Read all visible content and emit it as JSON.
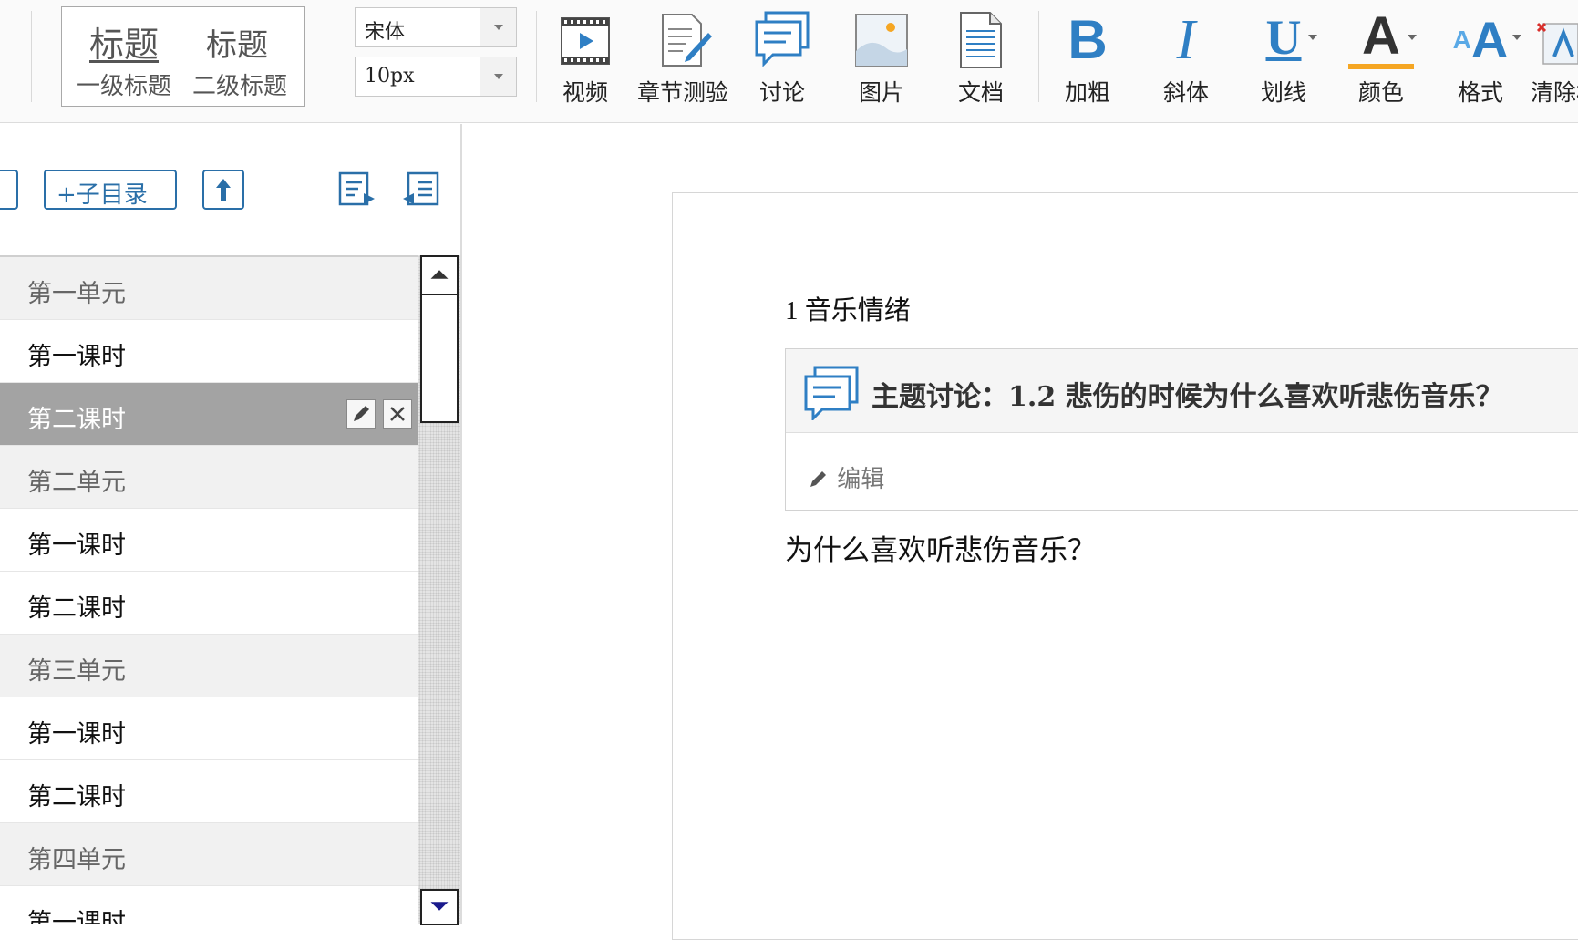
{
  "toolbar": {
    "heading": {
      "h1": "标题",
      "h2": "标题",
      "h1_sub": "一级标题",
      "h2_sub": "二级标题"
    },
    "font_family": "宋体",
    "font_size": "10px",
    "tools": {
      "video": "视频",
      "quiz": "章节测验",
      "discussion": "讨论",
      "image": "图片",
      "document": "文档",
      "bold": "加粗",
      "italic": "斜体",
      "underline": "划线",
      "color": "颜色",
      "format": "格式",
      "clear": "清除格"
    },
    "glyphs": {
      "bold": "B",
      "italic": "I",
      "underline": "U",
      "color": "A",
      "format": "A",
      "format_small": "A"
    }
  },
  "sidebar": {
    "add_child_label": "+子目录",
    "items": [
      {
        "label": "第一单元",
        "type": "unit"
      },
      {
        "label": "第一课时",
        "type": "lesson"
      },
      {
        "label": "第二课时",
        "type": "lesson",
        "selected": true
      },
      {
        "label": "第二单元",
        "type": "unit"
      },
      {
        "label": "第一课时",
        "type": "lesson"
      },
      {
        "label": "第二课时",
        "type": "lesson"
      },
      {
        "label": "第三单元",
        "type": "unit"
      },
      {
        "label": "第一课时",
        "type": "lesson"
      },
      {
        "label": "第二课时",
        "type": "lesson"
      },
      {
        "label": "第四单元",
        "type": "unit"
      },
      {
        "label": "第一课时",
        "type": "lesson"
      }
    ]
  },
  "content": {
    "section_title": "1 音乐情绪",
    "discussion": {
      "title": "主题讨论：1.2 悲伤的时候为什么喜欢听悲伤音乐？",
      "edit_label": "编辑"
    },
    "body": "为什么喜欢听悲伤音乐？"
  },
  "colors": {
    "accent": "#2a6fa8",
    "icon_blue": "#2f7fc4",
    "selected_row": "#a3a3a3",
    "color_bar": "#f5a623"
  }
}
